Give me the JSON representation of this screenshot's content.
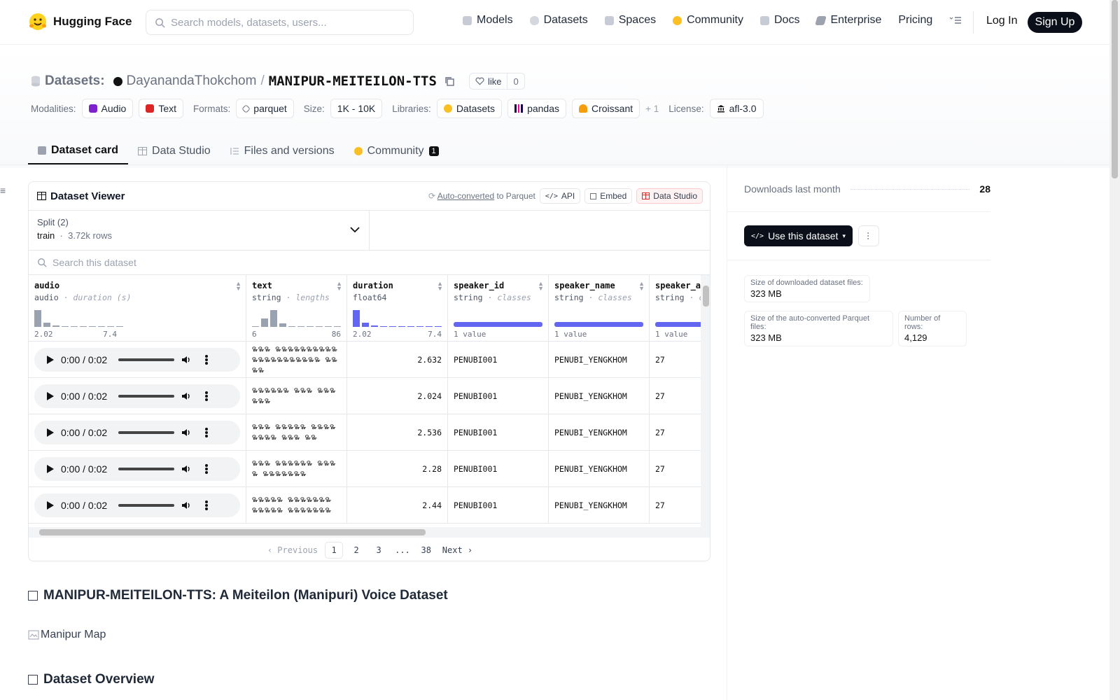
{
  "nav": {
    "brand": "Hugging Face",
    "search_placeholder": "Search models, datasets, users...",
    "links": [
      "Models",
      "Datasets",
      "Spaces",
      "Community",
      "Docs",
      "Enterprise",
      "Pricing"
    ],
    "login": "Log In",
    "signup": "Sign Up"
  },
  "header": {
    "section": "Datasets:",
    "owner": "DayanandaThokchom",
    "slash": "/",
    "name": "MANIPUR-MEITEILON-TTS",
    "like_label": "like",
    "like_count": "0",
    "modalities_label": "Modalities:",
    "modalities": [
      "Audio",
      "Text"
    ],
    "formats_label": "Formats:",
    "format": "parquet",
    "size_label": "Size:",
    "size": "1K - 10K",
    "libraries_label": "Libraries:",
    "libraries": [
      "Datasets",
      "pandas",
      "Croissant"
    ],
    "libraries_more": "+ 1",
    "license_label": "License:",
    "license": "afl-3.0"
  },
  "tabs": {
    "items": [
      "Dataset card",
      "Data Studio",
      "Files and versions",
      "Community"
    ],
    "community_badge": "1"
  },
  "viewer": {
    "title": "Dataset Viewer",
    "autoconv_link": "Auto-converted",
    "autoconv_rest": "to Parquet",
    "api": "API",
    "embed": "Embed",
    "studio": "Data Studio",
    "split_label": "Split (2)",
    "split_value": "train",
    "split_rows": "3.72k rows",
    "search_placeholder": "Search this dataset",
    "columns": [
      {
        "name": "audio",
        "type": "audio",
        "stat": "duration (s)",
        "min": "2.02",
        "max": "7.4"
      },
      {
        "name": "text",
        "type": "string",
        "stat": "lengths",
        "min": "6",
        "max": "86"
      },
      {
        "name": "duration",
        "type": "float64",
        "stat": "",
        "min": "2.02",
        "max": "7.4"
      },
      {
        "name": "speaker_id",
        "type": "string",
        "stat": "classes",
        "classes": "1 value"
      },
      {
        "name": "speaker_name",
        "type": "string",
        "stat": "classes",
        "classes": "1 value"
      },
      {
        "name": "speaker_a",
        "type": "string",
        "stat": "c",
        "classes": "1 value"
      }
    ],
    "histograms": {
      "audio": [
        0.85,
        0.22,
        0.08,
        0.04,
        0.04,
        0.04,
        0,
        0.04,
        0.04,
        0.04
      ],
      "text": [
        0.04,
        0.42,
        0.85,
        0.18,
        0.04,
        0.04,
        0.04,
        0.04,
        0,
        0.04
      ],
      "duration": [
        0.85,
        0.22,
        0.08,
        0.04,
        0.04,
        0.04,
        0,
        0.04,
        0.04,
        0.04
      ]
    },
    "rows": [
      {
        "time": "0:00 / 0:02",
        "text": "꯳꯳꯳ ꯳꯳꯳꯳꯳꯳꯳꯳꯳꯳ ꯳꯳꯳꯳꯳꯳꯳꯳꯳꯳꯳ ꯳꯳꯳꯳",
        "duration": "2.632",
        "speaker_id": "PENUBI001",
        "speaker_name": "PENUBI_YENGKHOM",
        "speaker_a": "27"
      },
      {
        "time": "0:00 / 0:02",
        "text": "꯳꯳꯳꯳꯳꯳ ꯳꯳꯳ ꯳꯳꯳꯳꯳꯳",
        "duration": "2.024",
        "speaker_id": "PENUBI001",
        "speaker_name": "PENUBI_YENGKHOM",
        "speaker_a": "27"
      },
      {
        "time": "0:00 / 0:02",
        "text": "꯳꯳꯳ ꯳꯳꯳꯳꯳ ꯳꯳꯳꯳ ꯳꯳꯳꯳ ꯳꯳꯳ ꯳꯳",
        "duration": "2.536",
        "speaker_id": "PENUBI001",
        "speaker_name": "PENUBI_YENGKHOM",
        "speaker_a": "27"
      },
      {
        "time": "0:00 / 0:02",
        "text": "꯳꯳꯳ ꯳꯳꯳꯳꯳꯳ ꯳꯳꯳꯳ ꯳꯳꯳꯳꯳꯳꯳",
        "duration": "2.28",
        "speaker_id": "PENUBI001",
        "speaker_name": "PENUBI_YENGKHOM",
        "speaker_a": "27"
      },
      {
        "time": "0:00 / 0:02",
        "text": "꯳꯳꯳꯳꯳ ꯳꯳꯳꯳꯳꯳꯳ ꯳꯳꯳꯳꯳ ꯳꯳꯳꯳꯳꯳꯳",
        "duration": "2.44",
        "speaker_id": "PENUBI001",
        "speaker_name": "PENUBI_YENGKHOM",
        "speaker_a": "27"
      }
    ],
    "pager": {
      "prev": "Previous",
      "pages": [
        "1",
        "2",
        "3",
        "...",
        "38"
      ],
      "next": "Next"
    }
  },
  "card": {
    "heading": "MANIPUR-MEITEILON-TTS: A Meiteilon (Manipuri) Voice Dataset",
    "image_alt": "Manipur Map",
    "heading2": "Dataset Overview"
  },
  "sidebar": {
    "downloads_label": "Downloads last month",
    "downloads_value": "28",
    "use_button": "Use this dataset",
    "downloaded_size_label": "Size of downloaded dataset files:",
    "downloaded_size": "323 MB",
    "parquet_size_label": "Size of the auto-converted Parquet files:",
    "parquet_size": "323 MB",
    "rows_label": "Number of rows:",
    "rows_value": "4,129"
  },
  "colors": {
    "accent": "#6366f1",
    "dark": "#0b0f19",
    "hist_gray": "#9aa1af"
  }
}
